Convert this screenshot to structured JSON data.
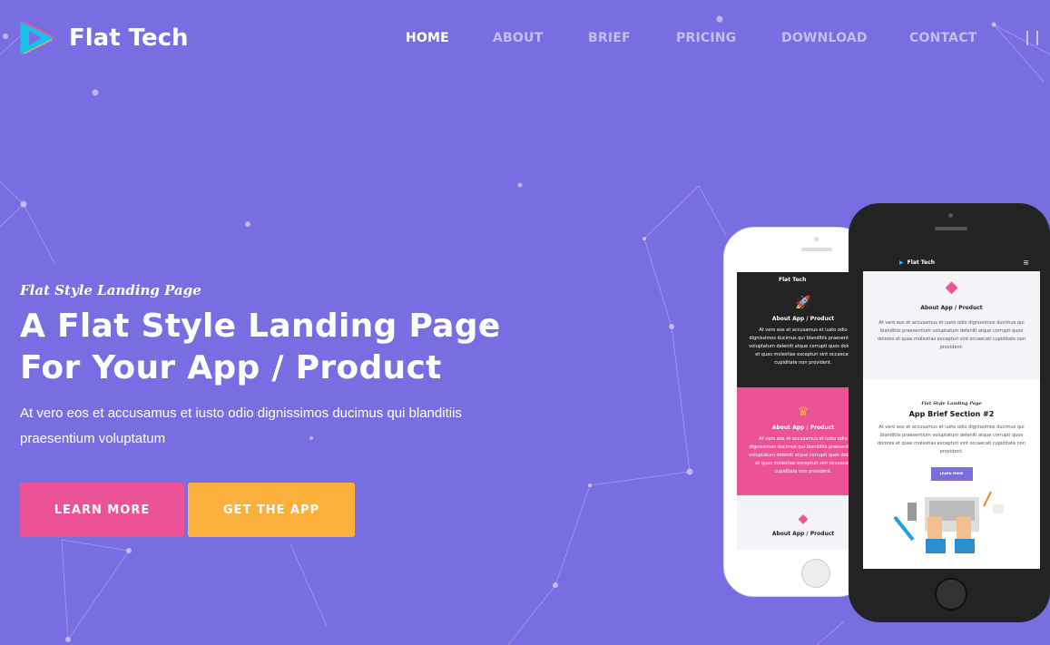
{
  "brand": {
    "name": "Flat Tech",
    "logo_icon": "play-triangle-logo"
  },
  "nav": {
    "items": [
      "HOME",
      "ABOUT",
      "BRIEF",
      "PRICING",
      "DOWNLOAD",
      "CONTACT"
    ],
    "active": "HOME",
    "menu_icon": "pause-bars-icon"
  },
  "hero": {
    "kicker": "Flat Style Landing Page",
    "title_line1": "A Flat Style Landing Page",
    "title_line2": "For Your App / Product",
    "description": "At vero eos et accusamus et iusto odio dignissimos ducimus qui blanditiis praesentium voluptatum",
    "learn_more": "LEARN MORE",
    "get_app": "GET THE APP"
  },
  "colors": {
    "background": "#786ee2",
    "pink": "#ec5296",
    "orange": "#fbb03b"
  },
  "phone_white": {
    "brand": "Flat Tech",
    "sections": [
      {
        "title": "About App / Product",
        "text": "At vero eos et accusamus et iusto odio dignissimos ducimus qui blanditiis praesentium voluptatum deleniti atque corrupti quos dolores et quas molestias excepturi sint occaecati cupiditate non provident."
      },
      {
        "title": "About App / Product",
        "text": "At vero eos et accusamus et iusto odio dignissimos ducimus qui blanditiis praesentium voluptatum deleniti atque corrupti quos dolores et quas molestias excepturi sint occaecati cupiditate non provident."
      },
      {
        "title": "About App / Product"
      }
    ]
  },
  "phone_black": {
    "brand": "Flat Tech",
    "about_title": "About App / Product",
    "about_text": "At vero eos et accusamus et iusto odio dignissimos ducimus qui blanditiis praesentium voluptatum deleniti atque corrupti quos dolores et quas molestias excepturi sint occaecati cupiditate non provident.",
    "kicker": "Flat Style Landing Page",
    "brief_title": "App Brief Section #2",
    "brief_text": "At vero eos et accusamus et iusto odio dignissimos ducimus qui blanditiis praesentium voluptatum deleniti atque corrupti quos dolores et quas molestias excepturi sint occaecati cupiditate non provident.",
    "button": "LEARN MORE"
  }
}
